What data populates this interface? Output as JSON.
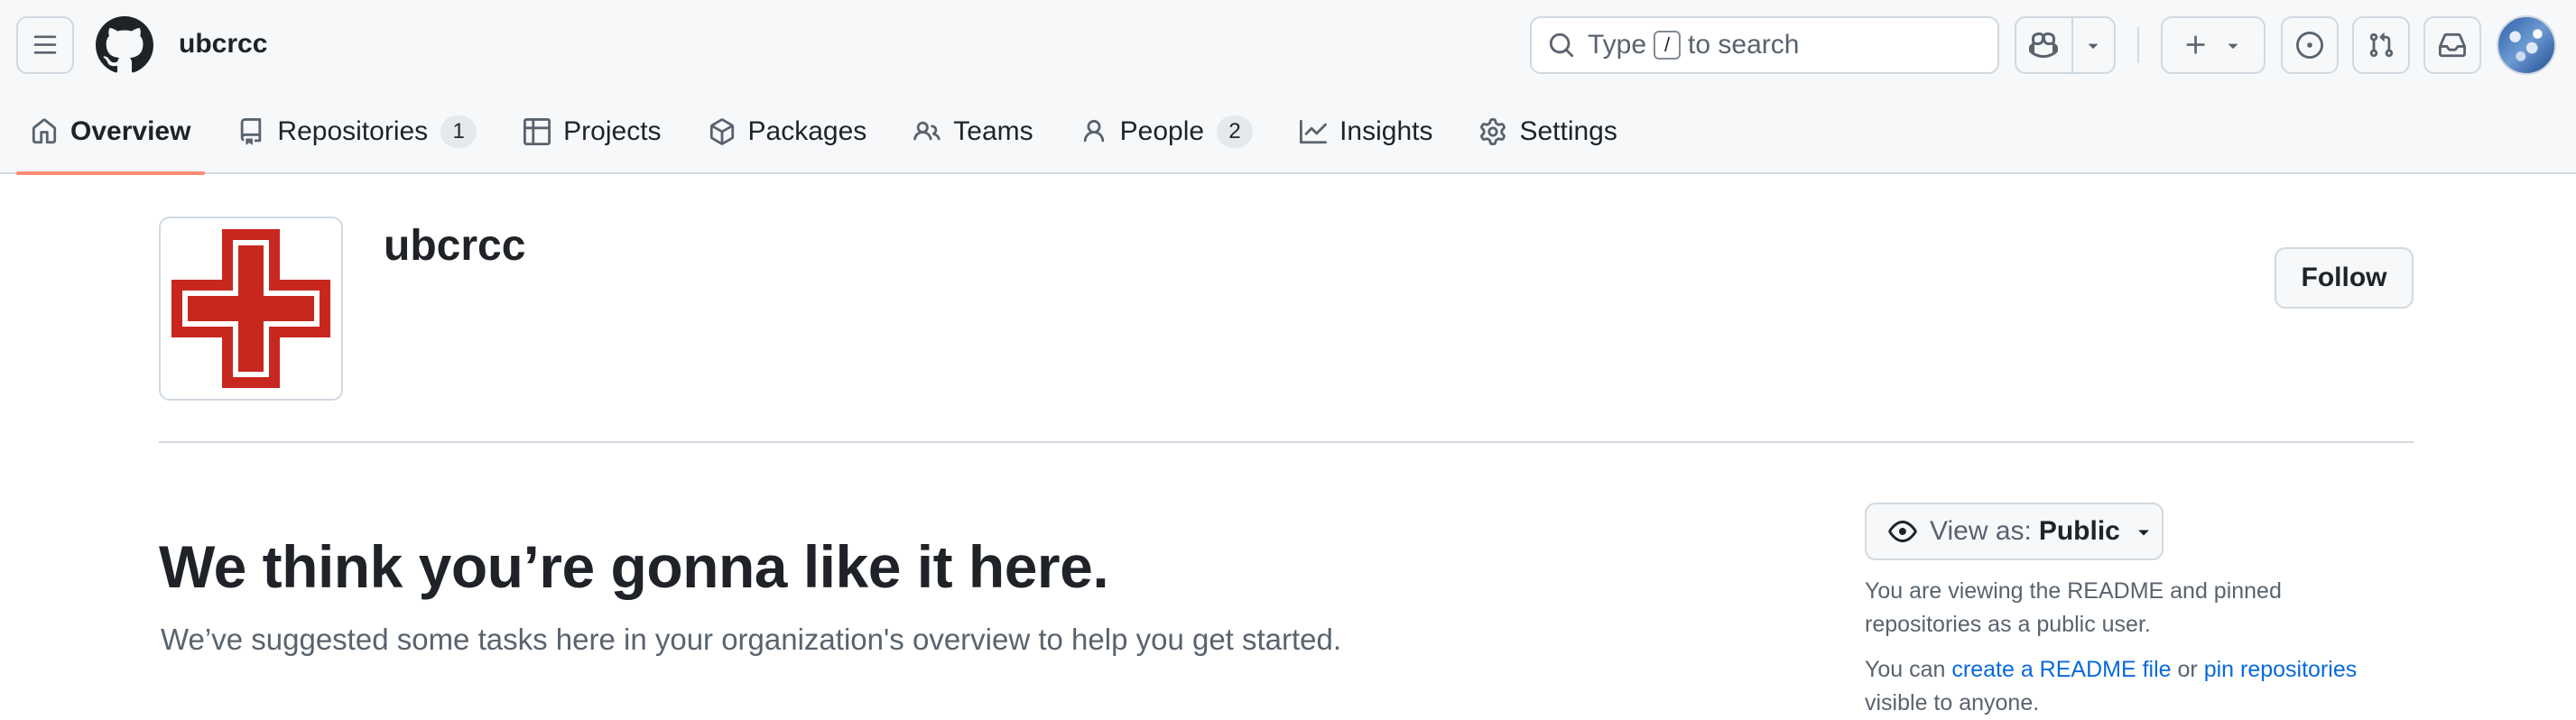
{
  "header": {
    "org_crumb": "ubcrcc",
    "search": {
      "prefix": "Type",
      "key": "/",
      "suffix": "to search"
    }
  },
  "tabs": [
    {
      "label": "Overview",
      "icon": "home-icon",
      "selected": true
    },
    {
      "label": "Repositories",
      "icon": "repo-icon",
      "count": "1"
    },
    {
      "label": "Projects",
      "icon": "table-icon"
    },
    {
      "label": "Packages",
      "icon": "package-icon"
    },
    {
      "label": "Teams",
      "icon": "people-icon"
    },
    {
      "label": "People",
      "icon": "person-icon",
      "count": "2"
    },
    {
      "label": "Insights",
      "icon": "graph-icon"
    },
    {
      "label": "Settings",
      "icon": "gear-icon"
    }
  ],
  "org": {
    "name": "ubcrcc",
    "follow_label": "Follow",
    "logo_color": "#c8271f"
  },
  "welcome": {
    "title": "We think you’re gonna like it here.",
    "subtitle": "We’ve suggested some tasks here in your organization's overview to help you get started."
  },
  "sidebar": {
    "view_as_label": "View as:",
    "view_as_value": "Public",
    "note": "You are viewing the README and pinned repositories as a public user.",
    "note2_prefix": "You can",
    "readme_link": "create a README file",
    "note2_or": "or",
    "pin_link": "pin repositories",
    "note2_suffix": "visible to anyone."
  },
  "colors": {
    "accent_underline": "#fd8c73",
    "link": "#0969da",
    "header_bg": "#f6f8fa"
  }
}
